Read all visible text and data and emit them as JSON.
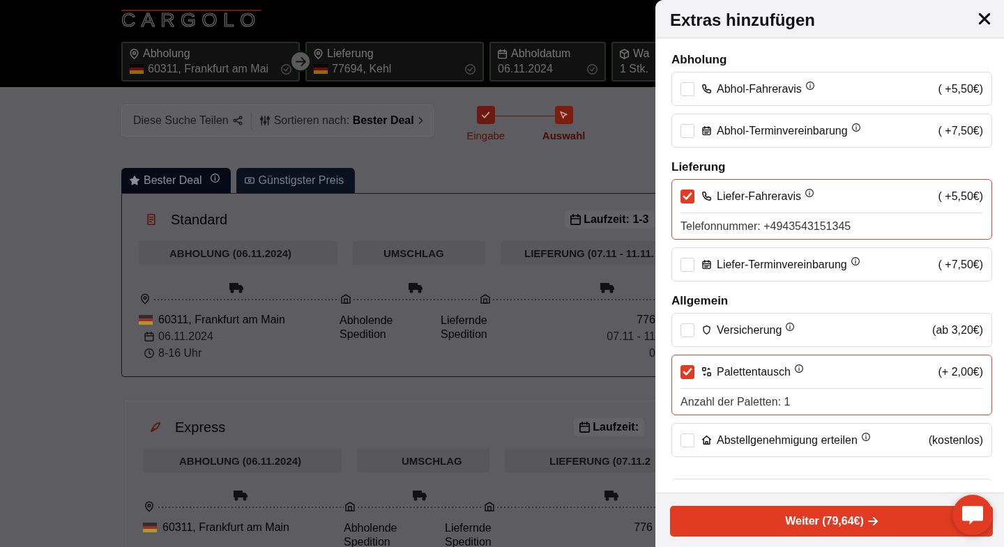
{
  "header": {
    "logo": "CARGOLO",
    "search_fields": [
      {
        "kind": "location",
        "label": "Abholung",
        "value": "60311, Frankfurt am Mai",
        "flag": true,
        "confirmed": true
      },
      {
        "kind": "location",
        "label": "Lieferung",
        "value": "77694, Kehl",
        "flag": true,
        "confirmed": true
      },
      {
        "kind": "date",
        "label": "Abholdatum",
        "value": "06.11.2024",
        "flag": false,
        "confirmed": true
      },
      {
        "kind": "package",
        "label": "Wa",
        "value": "1 Stk."
      }
    ]
  },
  "toolbar": {
    "share": "Diese Suche Teilen",
    "sort": "Sortieren nach: **Bester Deal**"
  },
  "steps": [
    {
      "label": "Eingabe",
      "done": true,
      "selected": false
    },
    {
      "label": "Auswahl",
      "done": false,
      "selected": true
    }
  ],
  "tabs": [
    {
      "label": "Bester Deal",
      "selected": true
    },
    {
      "label": "Günstigster Preis",
      "selected": false
    }
  ],
  "offers": [
    {
      "kind": "standard",
      "title": "Standard",
      "duration": "Laufzeit: 1-3",
      "phases": [
        "ABHOLUNG (06.11.2024)",
        "UMSCHLAG",
        "LIEFERUNG (07.11 - 11.11."
      ],
      "origin": "60311, Frankfurt am Main",
      "origin_date": "06.11.2024",
      "origin_time": "8-16 Uhr",
      "hubs": [
        "Abholende Spedition",
        "Liefernde Spedition"
      ],
      "destination": "776",
      "destination_date": "07.11 - 11",
      "destination_time": "0"
    },
    {
      "kind": "express",
      "title": "Express",
      "duration": "Laufzeit:",
      "phases": [
        "ABHOLUNG (06.11.2024)",
        "UMSCHLAG",
        "LIEFERUNG (07.11.2"
      ],
      "origin": "60311, Frankfurt am Main",
      "hubs": [
        "Abholende Spedition",
        "Liefernde Spedition"
      ],
      "destination": "776"
    }
  ],
  "drawer": {
    "title": "Extras hinzufügen",
    "sections": [
      {
        "title": "Abholung",
        "options": [
          {
            "kind": "driver_notice",
            "label": "Abhol-Fahreravis",
            "price": "( +5,50€)",
            "checked": false
          },
          {
            "kind": "appointment",
            "label": "Abhol-Terminvereinbarung",
            "price": "( +7,50€)",
            "checked": false
          }
        ]
      },
      {
        "title": "Lieferung",
        "options": [
          {
            "kind": "driver_notice",
            "label": "Liefer-Fahreravis",
            "price": "( +5,50€)",
            "checked": true,
            "detail": "Telefonnummer: +4943543151345"
          },
          {
            "kind": "appointment",
            "label": "Liefer-Terminvereinbarung",
            "price": "( +7,50€)",
            "checked": false
          }
        ]
      },
      {
        "title": "Allgemein",
        "options": [
          {
            "kind": "insurance",
            "label": "Versicherung",
            "price": "(ab 3,20€)",
            "checked": false
          },
          {
            "kind": "pallet_exchange",
            "label": "Palettentausch",
            "price": "(+ 2,00€)",
            "checked": true,
            "detail": "Anzahl der Paletten: 1"
          },
          {
            "kind": "drop_permit",
            "label": "Abstellgenehmigung erteilen",
            "price": "(kostenlos)",
            "checked": false
          }
        ]
      }
    ],
    "submit": "Weiter (79,64€)"
  }
}
